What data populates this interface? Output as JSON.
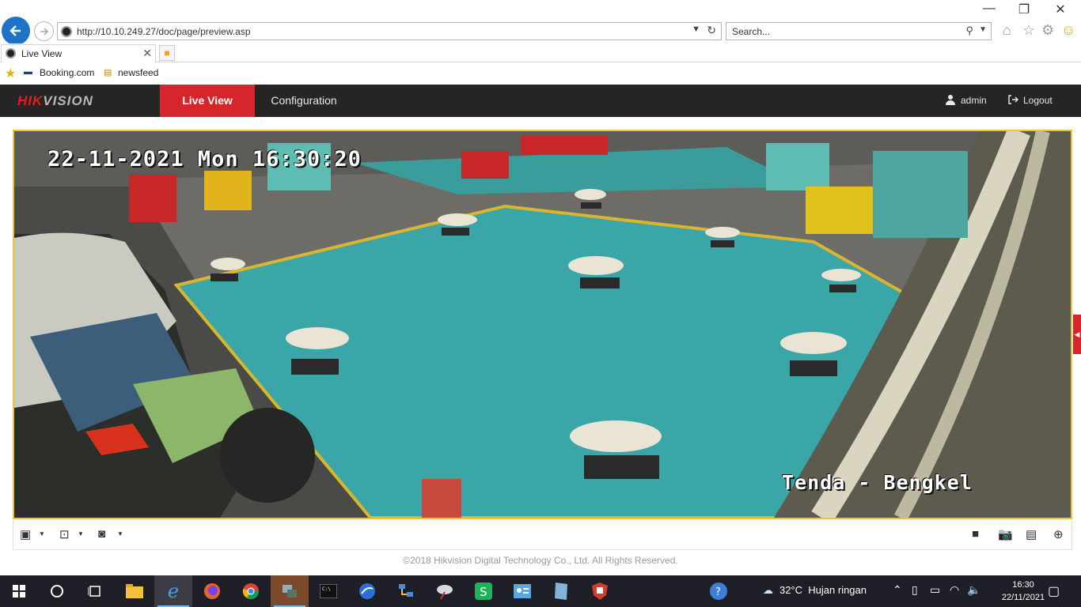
{
  "browser": {
    "url": "http://10.10.249.27/doc/page/preview.asp",
    "search_placeholder": "Search...",
    "tab_title": "Live View",
    "favorites": [
      {
        "label": "Booking.com"
      },
      {
        "label": "newsfeed"
      }
    ]
  },
  "header": {
    "logo_main": "HIK",
    "logo_rest": "VISION",
    "nav": [
      {
        "label": "Live View",
        "active": true
      },
      {
        "label": "Configuration",
        "active": false
      }
    ],
    "user": "admin",
    "logout": "Logout",
    "accent_color": "#d7262b"
  },
  "video": {
    "osd_datetime": "22-11-2021 Mon 16:30:20",
    "osd_camera_name": "Tenda - Bengkel"
  },
  "footer": {
    "copyright": "©2018 Hikvision Digital Technology Co., Ltd. All Rights Reserved."
  },
  "taskbar": {
    "weather_temp": "32°C",
    "weather_text": "Hujan ringan",
    "time": "16:30",
    "date": "22/11/2021",
    "apps": [
      "file-explorer-icon",
      "internet-explorer-icon",
      "firefox-icon",
      "chrome-icon",
      "app-manager-icon",
      "terminal-icon",
      "browser-blue-icon",
      "network-icon",
      "satellite-icon",
      "spreadsheet-icon",
      "contact-card-icon",
      "book-icon",
      "shield-app-icon"
    ]
  }
}
